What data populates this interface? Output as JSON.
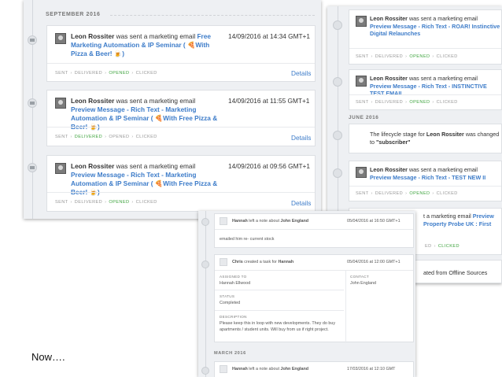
{
  "steps": {
    "sent": "SENT",
    "delivered": "DELIVERED",
    "opened": "OPENED",
    "clicked": "CLICKED"
  },
  "details_label": "Details",
  "left": {
    "month": "SEPTEMBER 2016",
    "items": [
      {
        "who": "Leon Rossiter",
        "pre": "was sent a marketing email",
        "link": "Free Marketing Automation & IP Seminar ( 🍕With Pizza & Beer! 🍺)",
        "time": "14/09/2016 at 14:34 GMT+1"
      },
      {
        "who": "Leon Rossiter",
        "pre": "was sent a marketing email",
        "link": "Preview Message - Rich Text - Marketing Automation & IP Seminar ( 🍕With Free Pizza & Beer! 🍺)",
        "time": "14/09/2016 at 11:55 GMT+1"
      },
      {
        "who": "Leon Rossiter",
        "pre": "was sent a marketing email",
        "link": "Preview Message - Rich Text - Marketing Automation & IP Seminar ( 🍕With Free Pizza & Beer! 🍺)",
        "time": "14/09/2016 at 09:56 GMT+1"
      }
    ]
  },
  "right": {
    "items": [
      {
        "who": "Leon Rossiter",
        "pre": "was sent a marketing email",
        "link": "Preview Message - Rich Text - ROAR! Instinctive Digital Relaunches"
      },
      {
        "who": "Leon Rossiter",
        "pre": "was sent a marketing email",
        "link": "Preview Message - Rich Text - INSTINCTIVE TEST EMAIL"
      }
    ],
    "month": "JUNE 2016",
    "lifecycle": {
      "pre": "The lifecycle stage for",
      "who": "Leon Rossiter",
      "post": "was changed to",
      "value": "\"subscriber\""
    },
    "item3": {
      "who": "Leon Rossiter",
      "pre": "was sent a marketing email",
      "link": "Preview Message - Rich Text - TEST NEW II"
    },
    "partial_line1": "t a marketing email",
    "partial_link1": "Preview",
    "partial_link2": "Property Probe UK : First",
    "partial_steps": "ED",
    "partial_clicked": "CLICKED",
    "partial_offline": "ated from Offline Sources"
  },
  "bottom": {
    "note1": {
      "who": "Hannah",
      "action": "left a note about",
      "target": "John England",
      "time": "05/04/2016 at 16:50 GMT+1",
      "body": "emailed him re- current stock"
    },
    "task": {
      "who": "Chris",
      "action": "created a task for",
      "target": "Hannah",
      "time": "05/04/2016 at 12:00 GMT+1",
      "assigned_label": "ASSIGNED TO",
      "assigned": "Hannah Ellwood",
      "contact_label": "CONTACT",
      "contact": "John England",
      "status_label": "STATUS",
      "status": "Completed",
      "desc_label": "DESCRIPTION",
      "desc": "Please keep this in loop with new developments. They do buy apartments / student units. Will buy from us if right project."
    },
    "month": "MARCH 2016",
    "note2": {
      "who": "Hannah",
      "action": "left a note about",
      "target": "John England",
      "time": "17/03/2016 at 12:10 GMT"
    }
  },
  "caption": "Now…."
}
